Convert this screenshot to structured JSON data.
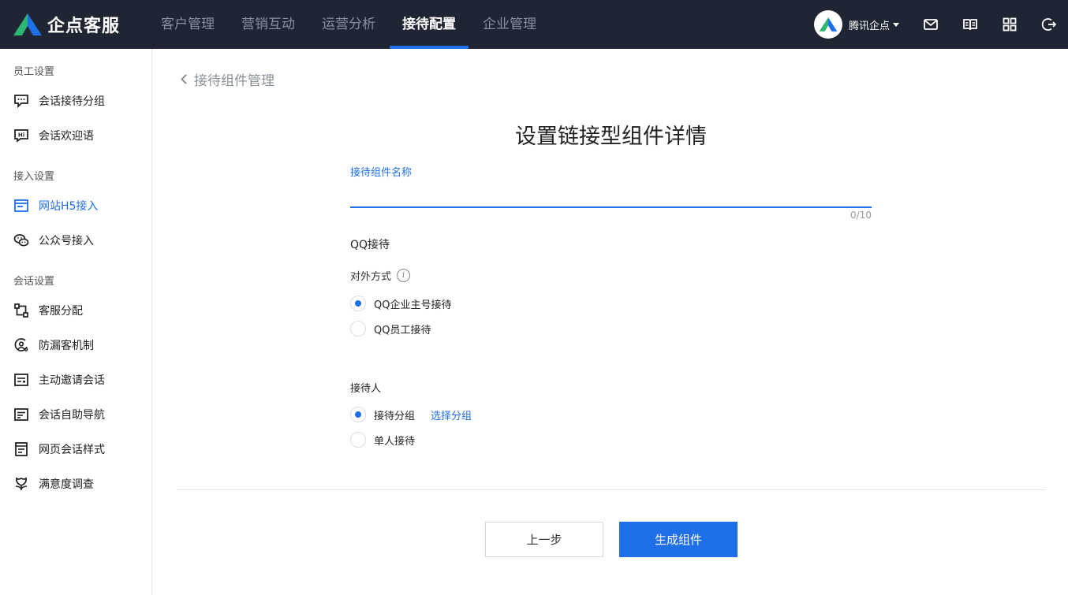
{
  "app": {
    "name": "企点客服",
    "account": "腾讯企点"
  },
  "nav": [
    {
      "label": "客户管理",
      "active": false
    },
    {
      "label": "营销互动",
      "active": false
    },
    {
      "label": "运营分析",
      "active": false
    },
    {
      "label": "接待配置",
      "active": true
    },
    {
      "label": "企业管理",
      "active": false
    }
  ],
  "tools": [
    "mail-icon",
    "book-icon",
    "apps-grid-icon",
    "logout-icon"
  ],
  "sidebar": {
    "groups": [
      "员工设置",
      "接入设置",
      "会话设置"
    ],
    "items": [
      {
        "label": "会话接待分组",
        "icon": "chat-group-icon"
      },
      {
        "label": "会话欢迎语",
        "icon": "hi-icon"
      },
      {
        "label": "网站H5接入",
        "icon": "web-window-icon"
      },
      {
        "label": "公众号接入",
        "icon": "wechat-icon"
      },
      {
        "label": "客服分配",
        "icon": "distribute-icon"
      },
      {
        "label": "防漏客机制",
        "icon": "shield-user-icon"
      },
      {
        "label": "主动邀请会话",
        "icon": "invite-card-icon"
      },
      {
        "label": "会话自助导航",
        "icon": "nav-message-icon"
      },
      {
        "label": "网页会话样式",
        "icon": "page-style-icon"
      },
      {
        "label": "满意度调查",
        "icon": "flower-icon"
      }
    ]
  },
  "main": {
    "back_label": "接待组件管理",
    "title": "设置链接型组件详情",
    "name_label": "接待组件名称",
    "name_value": "",
    "counter": "0/10",
    "qq_section": "QQ接待",
    "external_label": "对外方式",
    "info_glyph": "i",
    "radio_qq_enterprise": "QQ企业主号接待",
    "radio_qq_staff": "QQ员工接待",
    "receiver_label": "接待人",
    "radio_group": "接待分组",
    "select_group_link": "选择分组",
    "radio_single": "单人接待",
    "btn_prev": "上一步",
    "btn_generate": "生成组件"
  }
}
